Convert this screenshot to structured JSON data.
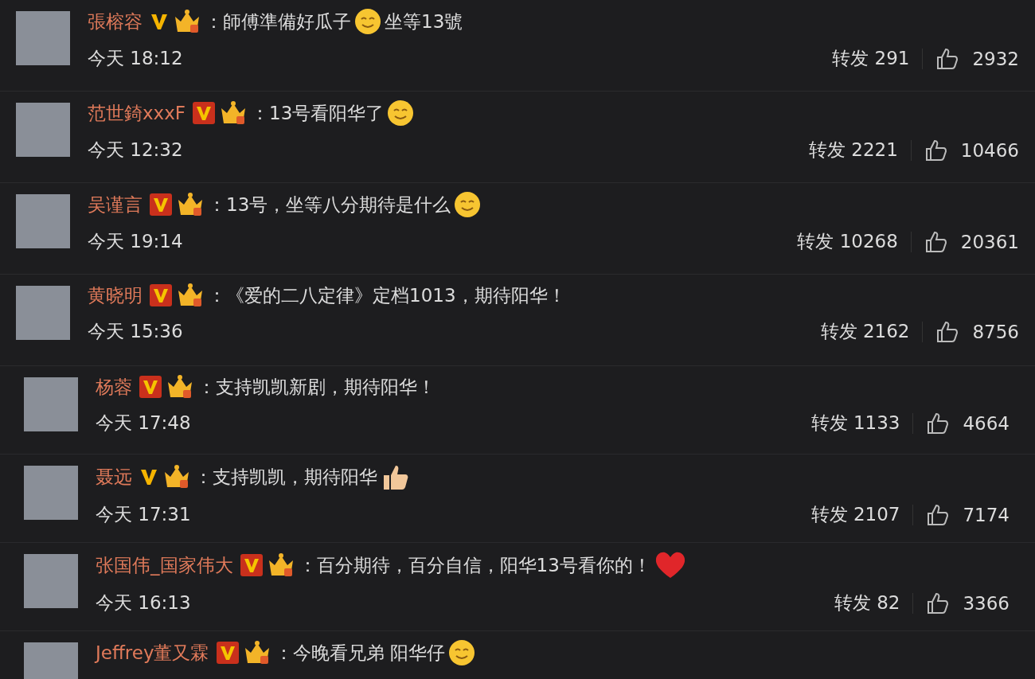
{
  "comments": [
    {
      "name": "張榕容",
      "verified_boxed": false,
      "text": "：師傅準備好瓜子",
      "emojis": [
        {
          "kind": "face"
        }
      ],
      "text_after": "坐等13號",
      "time": "今天 18:12",
      "reposts": "转发 291",
      "likes": "2932"
    },
    {
      "name": "范世錡xxxF",
      "verified_boxed": true,
      "text": "：13号看阳华了",
      "emojis": [
        {
          "kind": "face"
        }
      ],
      "time": "今天 12:32",
      "reposts": "转发 2221",
      "likes": "10466"
    },
    {
      "name": "吴谨言",
      "verified_boxed": true,
      "text": "：13号，坐等八分期待是什么",
      "emojis": [
        {
          "kind": "face"
        }
      ],
      "time": "今天 19:14",
      "reposts": "转发 10268",
      "likes": "20361"
    },
    {
      "name": "黄晓明",
      "verified_boxed": true,
      "text": "：《爱的二八定律》定档1013，期待阳华！",
      "time": "今天 15:36",
      "reposts": "转发 2162",
      "likes": "8756",
      "children": [
        {
          "name": "杨蓉",
          "verified_boxed": true,
          "text": "：支持凯凯新剧，期待阳华！",
          "time": "今天 17:48",
          "reposts": "转发 1133",
          "likes": "4664"
        },
        {
          "name": "聂远",
          "verified_boxed": false,
          "text": "：支持凯凯，期待阳华",
          "emojis": [
            {
              "kind": "thumb"
            }
          ],
          "time": "今天 17:31",
          "reposts": "转发 2107",
          "likes": "7174"
        },
        {
          "name": "张国伟_国家伟大",
          "verified_boxed": true,
          "text": "：百分期待，百分自信，阳华13号看你的！",
          "emojis": [
            {
              "kind": "heart"
            }
          ],
          "time": "今天 16:13",
          "reposts": "转发 82",
          "likes": "3366"
        },
        {
          "name": "Jeffrey董又霖",
          "verified_boxed": true,
          "text": "：今晚看兄弟 阳华仔",
          "emojis": [
            {
              "kind": "face"
            }
          ]
        }
      ]
    }
  ]
}
